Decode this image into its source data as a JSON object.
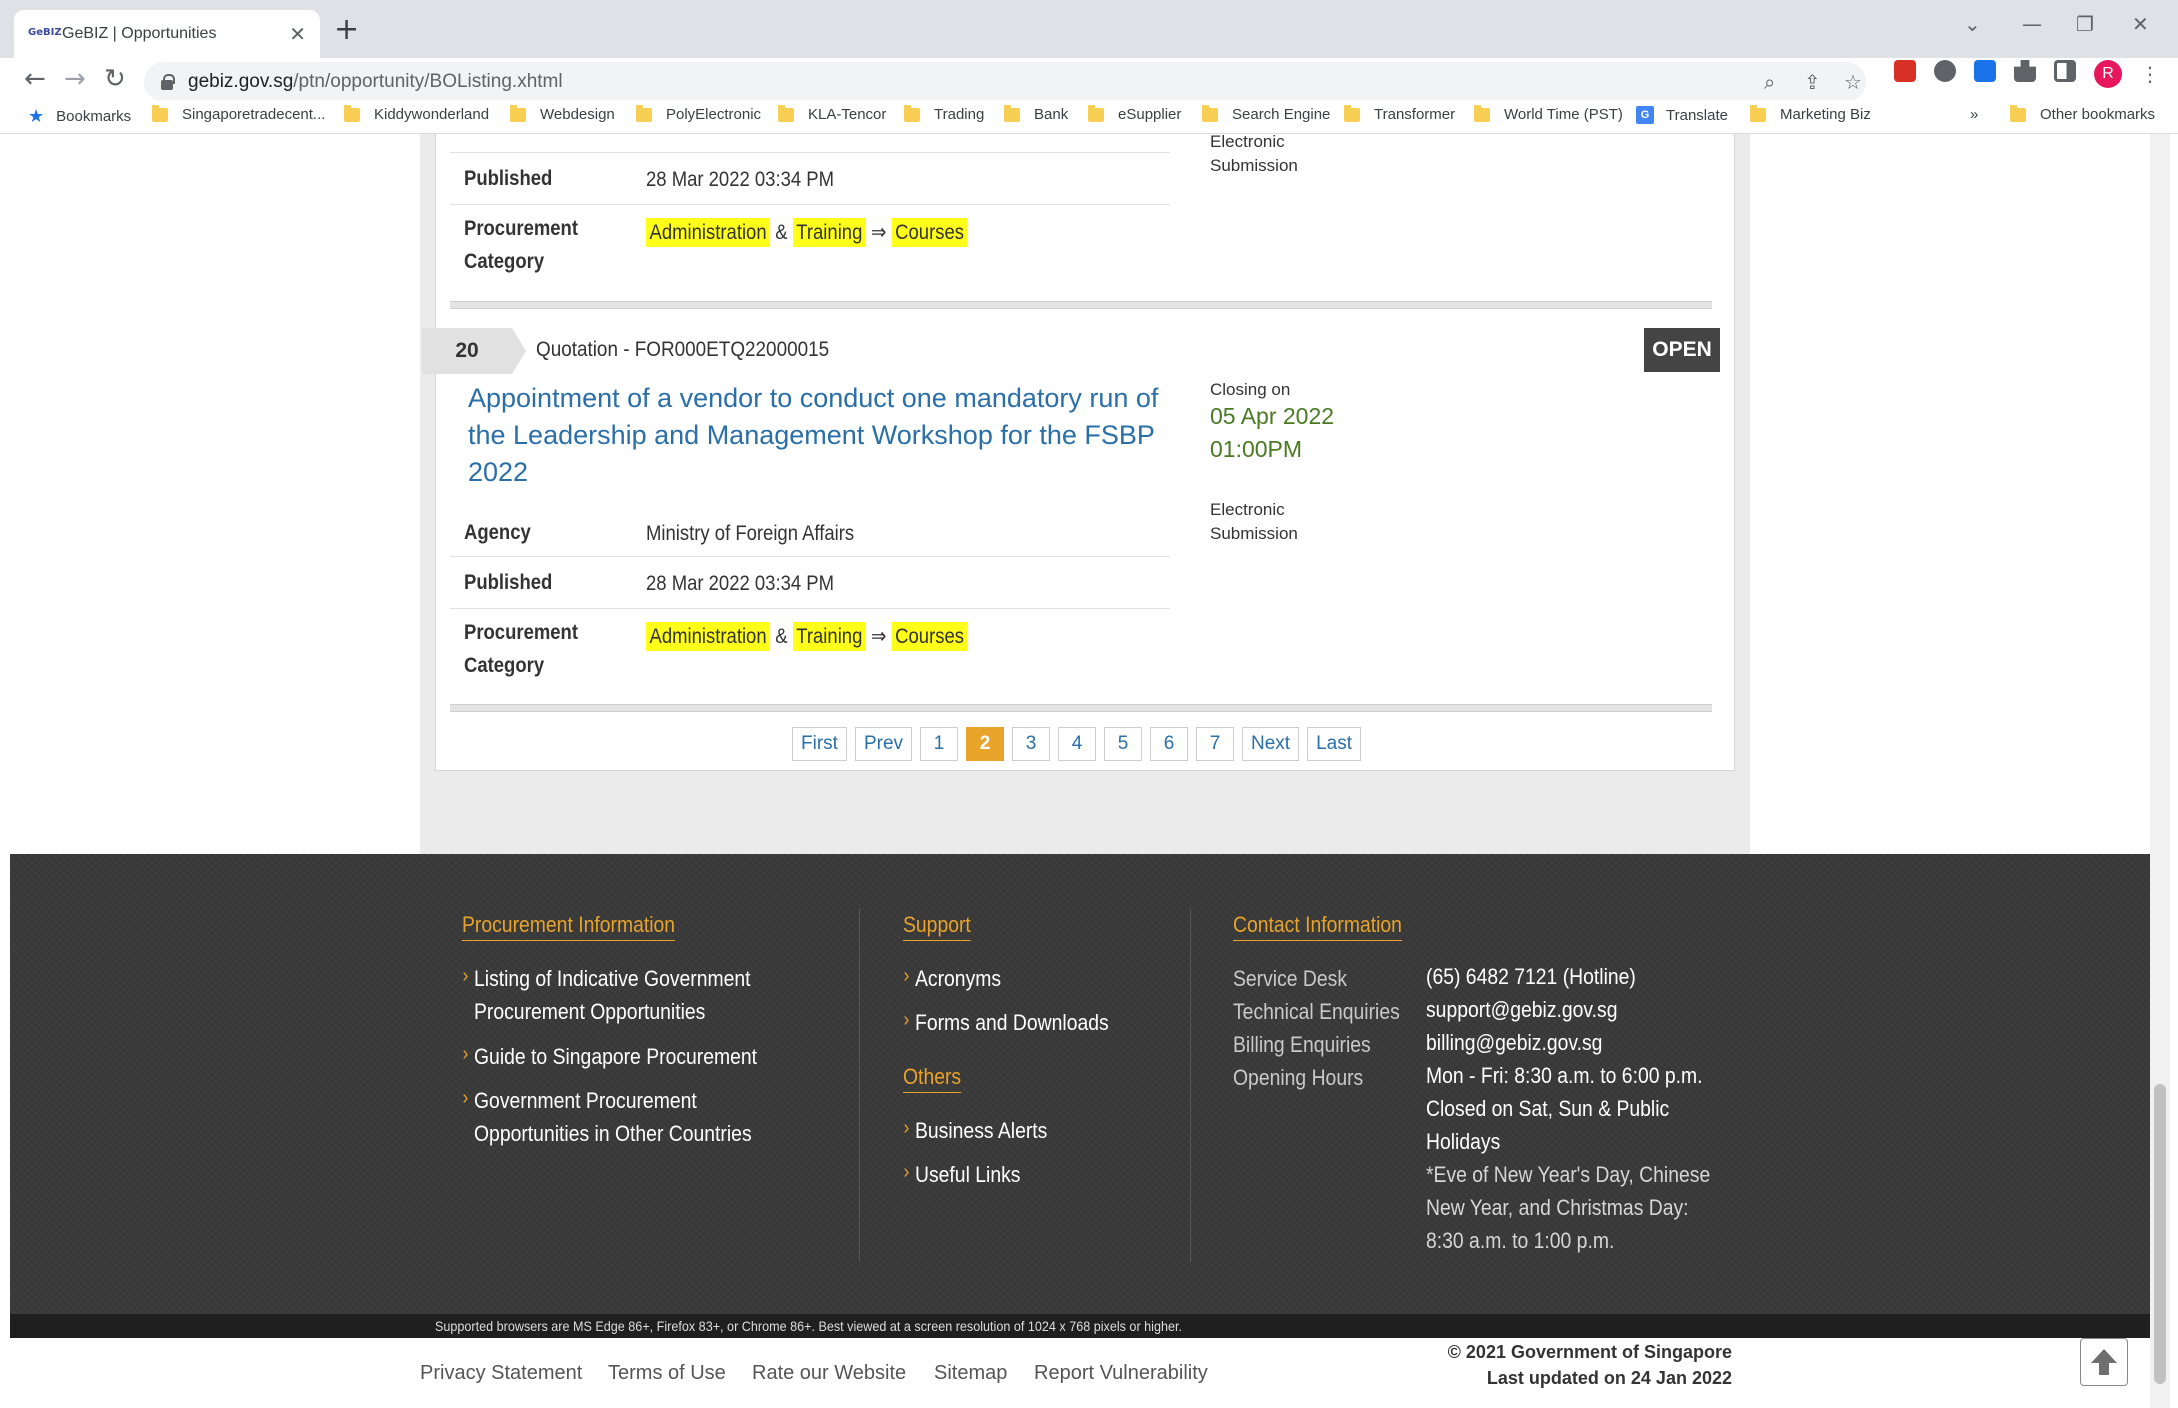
{
  "browser": {
    "tab_title": "GeBIZ | Opportunities",
    "url_host": "gebiz.gov.sg",
    "url_path": "/ptn/opportunity/BOListing.xhtml",
    "profile_initial": "R",
    "bookmarks": [
      "Bookmarks",
      "Singaporetradecent...",
      "Kiddywonderland",
      "Webdesign",
      "PolyElectronic",
      "KLA-Tencor",
      "Trading",
      "Bank",
      "eSupplier",
      "Search Engine",
      "Transformer",
      "World Time (PST)",
      "Translate",
      "Marketing Biz"
    ],
    "more_bookmarks": "»",
    "other_bookmarks": "Other bookmarks"
  },
  "prev_item": {
    "published_label": "Published",
    "published_value": "28 Mar 2022 03:34 PM",
    "category_label_1": "Procurement",
    "category_label_2": "Category",
    "cat_a": "Administration",
    "cat_amp": "&",
    "cat_b": "Training",
    "cat_arrow": "⇒",
    "cat_c": "Courses",
    "submission_1": "Electronic",
    "submission_2": "Submission"
  },
  "item": {
    "number": "20",
    "reference": "Quotation - FOR000ETQ22000015",
    "status": "OPEN",
    "title": "Appointment of a vendor to conduct one mandatory run of the Leadership and Management Workshop for the FSBP 2022",
    "agency_label": "Agency",
    "agency_value": "Ministry of Foreign Affairs",
    "published_label": "Published",
    "published_value": "28 Mar 2022 03:34 PM",
    "category_label_1": "Procurement",
    "category_label_2": "Category",
    "cat_a": "Administration",
    "cat_amp": "&",
    "cat_b": "Training",
    "cat_arrow": "⇒",
    "cat_c": "Courses",
    "closing_label": "Closing on",
    "closing_date": "05 Apr 2022",
    "closing_time": "01:00PM",
    "submission_1": "Electronic",
    "submission_2": "Submission"
  },
  "pagination": [
    "First",
    "Prev",
    "1",
    "2",
    "3",
    "4",
    "5",
    "6",
    "7",
    "Next",
    "Last"
  ],
  "pagination_current": "2",
  "footer": {
    "procurement_heading": "Procurement Information",
    "procurement_links": [
      [
        "Listing of Indicative Government",
        "Procurement Opportunities"
      ],
      [
        "Guide to Singapore Procurement"
      ],
      [
        "Government Procurement",
        "Opportunities in Other Countries"
      ]
    ],
    "support_heading": "Support",
    "support_links": [
      "Acronyms",
      "Forms and Downloads"
    ],
    "others_heading": "Others",
    "others_links": [
      "Business Alerts",
      "Useful Links"
    ],
    "contact_heading": "Contact Information",
    "contact_labels": [
      "Service Desk",
      "Technical Enquiries",
      "Billing Enquiries",
      "Opening Hours"
    ],
    "contact_values": [
      "(65) 6482 7121 (Hotline)",
      "support@gebiz.gov.sg",
      "billing@gebiz.gov.sg",
      "Mon - Fri: 8:30 a.m. to 6:00 p.m.",
      "Closed on Sat, Sun & Public",
      "Holidays"
    ],
    "contact_note": [
      "*Eve of New Year's Day, Chinese",
      "New Year, and Christmas Day:",
      "8:30 a.m. to 1:00 p.m."
    ],
    "browsers_note": "Supported browsers are MS Edge 86+, Firefox 83+, or Chrome 86+. Best viewed at a screen resolution of 1024 x 768 pixels or higher.",
    "bottom_links": [
      "Privacy Statement",
      "Terms of Use",
      "Rate our Website",
      "Sitemap",
      "Report Vulnerability"
    ],
    "copyright": "© 2021 Government of Singapore",
    "last_updated": "Last updated on 24 Jan 2022"
  },
  "colors": {
    "accent": "#e8a32a",
    "link": "#2a6fa8",
    "highlight": "#ffff1a",
    "closing_green": "#4a7a23",
    "status_bg": "#444444"
  }
}
